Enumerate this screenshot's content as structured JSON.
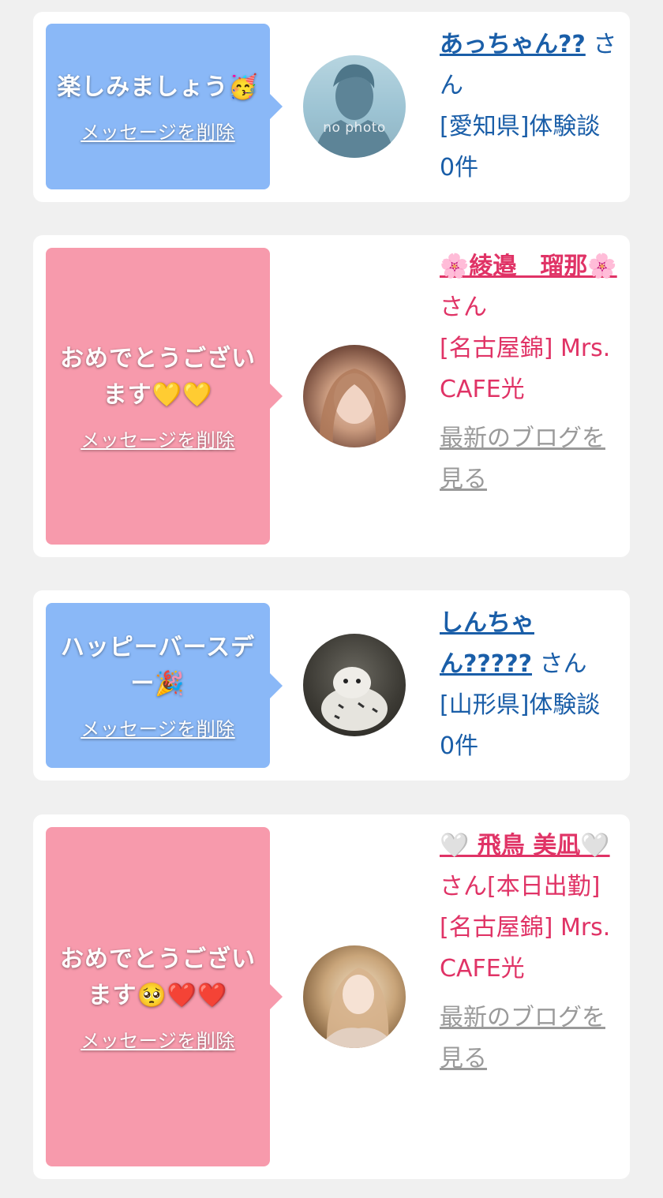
{
  "items": [
    {
      "message": "楽しみましょう🥳",
      "delete_label": "メッセージを削除",
      "avatar_label": "no photo",
      "name": "あっちゃん??",
      "suffix": " さん",
      "detail": "[愛知県]体験談 0件"
    },
    {
      "message": "おめでとうございます💛💛",
      "delete_label": "メッセージを削除",
      "name": "🌸綾邉　瑠那🌸",
      "suffix": " さん",
      "detail": "[名古屋錦] Mrs.CAFE光",
      "blog": "最新のブログを見る"
    },
    {
      "message": "ハッピーバースデー🎉",
      "delete_label": "メッセージを削除",
      "name": "しんちゃん?????",
      "suffix": " さん",
      "detail": "[山形県]体験談 0件"
    },
    {
      "message": "おめでとうございます🥺❤️❤️",
      "delete_label": "メッセージを削除",
      "name": "🤍 飛鳥 美凪🤍",
      "suffix": " さん[本日出勤]",
      "detail": "[名古屋錦] Mrs.CAFE光",
      "blog": "最新のブログを見る"
    }
  ],
  "colors": {
    "blue_bubble": "#8ab8f7",
    "pink_bubble": "#f79aac",
    "blue_text": "#1a5ea8",
    "pink_text": "#e03366"
  }
}
